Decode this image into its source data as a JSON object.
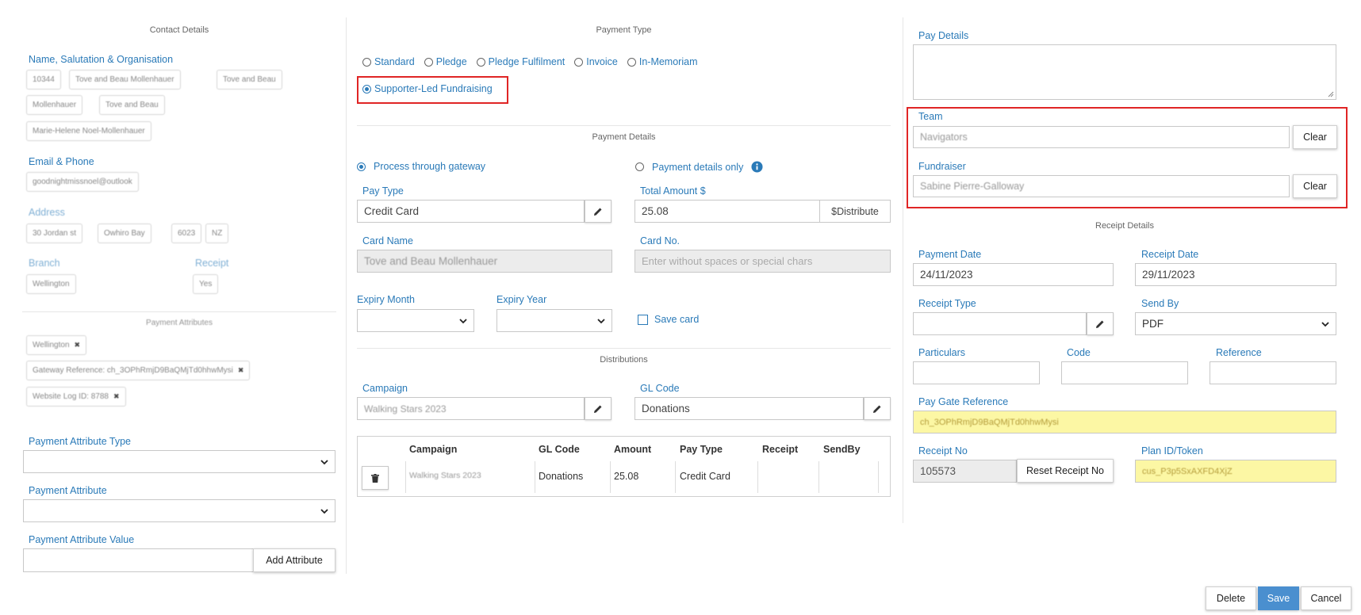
{
  "contact": {
    "section_title": "Contact Details",
    "name_label": "Name, Salutation & Organisation",
    "name_chips": [
      "10344",
      "Tove and Beau Mollenhauer",
      "Tove and Beau",
      "Mollenhauer",
      "Tove and Beau",
      "Marie-Helene Noel-Mollenhauer"
    ],
    "email_label": "Email & Phone",
    "email_chip": "goodnightmissnoel@outlook",
    "address_label": "Address",
    "address_chips": [
      "30 Jordan st",
      "Owhiro Bay",
      "6023",
      "NZ"
    ],
    "branch_label": "Branch",
    "branch_value": "Wellington",
    "receipt_label": "Receipt",
    "receipt_value": "Yes"
  },
  "payment_attributes": {
    "section_title": "Payment Attributes",
    "chips": [
      "Wellington",
      "Gateway Reference: ch_3OPhRmjD9BaQMjTd0hhwMysi",
      "Website Log ID: 8788"
    ],
    "type_label": "Payment Attribute Type",
    "attribute_label": "Payment Attribute",
    "value_label": "Payment Attribute Value",
    "add_button": "Add Attribute"
  },
  "payment_type": {
    "section_title": "Payment Type",
    "options": [
      "Standard",
      "Pledge",
      "Pledge Fulfilment",
      "Invoice",
      "In-Memoriam"
    ],
    "selected": "Supporter-Led Fundraising"
  },
  "payment_details": {
    "section_title": "Payment Details",
    "gateway_option": "Process through gateway",
    "details_only_option": "Payment details only",
    "pay_type_label": "Pay Type",
    "pay_type_value": "Credit Card",
    "total_label": "Total Amount $",
    "total_value": "25.08",
    "distribute_button": "$Distribute",
    "card_name_label": "Card Name",
    "card_name_value": "Tove and Beau  Mollenhauer",
    "card_no_label": "Card No.",
    "card_no_placeholder": "Enter without spaces or special chars",
    "expiry_month_label": "Expiry Month",
    "expiry_year_label": "Expiry Year",
    "save_card_label": "Save card"
  },
  "distributions": {
    "section_title": "Distributions",
    "campaign_label": "Campaign",
    "campaign_value": "Walking Stars 2023",
    "gl_label": "GL Code",
    "gl_value": "Donations",
    "columns": [
      "Campaign",
      "GL Code",
      "Amount",
      "Pay Type",
      "Receipt",
      "SendBy"
    ],
    "rows": [
      {
        "campaign": "Walking Stars 2023",
        "gl_code": "Donations",
        "amount": "25.08",
        "pay_type": "Credit Card",
        "receipt": "",
        "send_by": ""
      }
    ]
  },
  "right": {
    "pay_details_label": "Pay Details",
    "team_label": "Team",
    "team_value": "Navigators",
    "fundraiser_label": "Fundraiser",
    "fundraiser_value": "Sabine Pierre-Galloway",
    "clear_button": "Clear",
    "receipt_section_title": "Receipt Details",
    "payment_date_label": "Payment Date",
    "payment_date_value": "24/11/2023",
    "receipt_date_label": "Receipt Date",
    "receipt_date_value": "29/11/2023",
    "receipt_type_label": "Receipt Type",
    "send_by_label": "Send By",
    "send_by_value": "PDF",
    "particulars_label": "Particulars",
    "code_label": "Code",
    "reference_label": "Reference",
    "pay_gate_label": "Pay Gate Reference",
    "pay_gate_value": "ch_3OPhRmjD9BaQMjTd0hhwMysi",
    "receipt_no_label": "Receipt No",
    "receipt_no_value": "105573",
    "reset_button": "Reset Receipt No",
    "plan_label": "Plan ID/Token",
    "plan_value": "cus_P3p5SxAXFD4XjZ"
  },
  "footer": {
    "delete_button": "Delete",
    "save_button": "Save",
    "cancel_button": "Cancel"
  },
  "colors": {
    "label_blue": "#2a7ab8",
    "highlight_red": "#e02525",
    "save_blue": "#4a8fcf",
    "yellow_field": "#fcf7a4"
  }
}
